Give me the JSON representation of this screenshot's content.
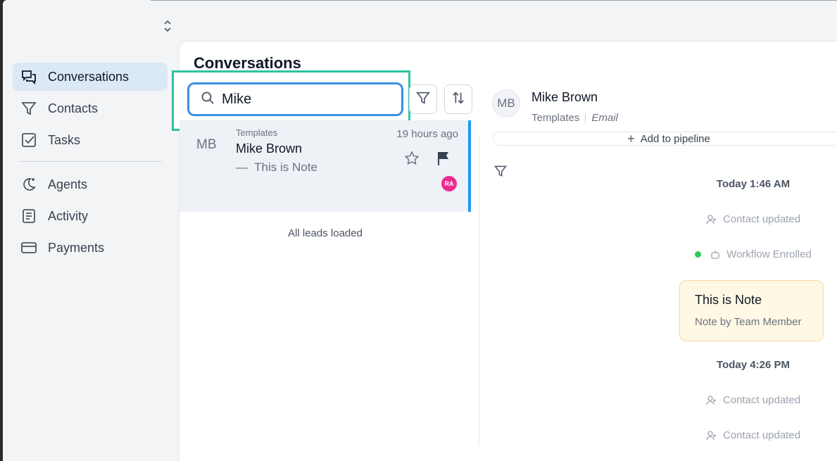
{
  "sidebar": {
    "items": [
      {
        "label": "Conversations",
        "icon": "conversations-icon",
        "active": true
      },
      {
        "label": "Contacts",
        "icon": "filter-icon"
      },
      {
        "label": "Tasks",
        "icon": "checkbox-icon"
      },
      {
        "label": "Agents",
        "icon": "sparkle-moon-icon"
      },
      {
        "label": "Activity",
        "icon": "list-doc-icon"
      },
      {
        "label": "Payments",
        "icon": "card-icon"
      }
    ]
  },
  "main": {
    "title": "Conversations",
    "search": {
      "value": "Mike",
      "placeholder": ""
    },
    "conversation": {
      "avatar": "MB",
      "source": "Templates",
      "name": "Mike Brown",
      "preview_dash": "—",
      "preview": "This is Note",
      "time": "19 hours ago",
      "badge": "RA"
    },
    "all_loaded": "All leads loaded"
  },
  "detail": {
    "avatar": "MB",
    "name": "Mike Brown",
    "source": "Templates",
    "channel": "Email",
    "pipeline_label": "Add to pipeline",
    "timeline": {
      "date1": "Today 1:46 AM",
      "event1": "Contact updated",
      "event2": "Workflow Enrolled",
      "note_title": "This is Note",
      "note_sub": "Note by Team Member",
      "date2": "Today 4:26 PM",
      "event3": "Contact updated",
      "event4": "Contact updated"
    }
  },
  "colors": {
    "accent_blue": "#1d9bf0",
    "search_border": "#3b8fe0",
    "highlight": "#2ec4a0",
    "badge": "#ec2b8c",
    "status_dot": "#34c759"
  }
}
